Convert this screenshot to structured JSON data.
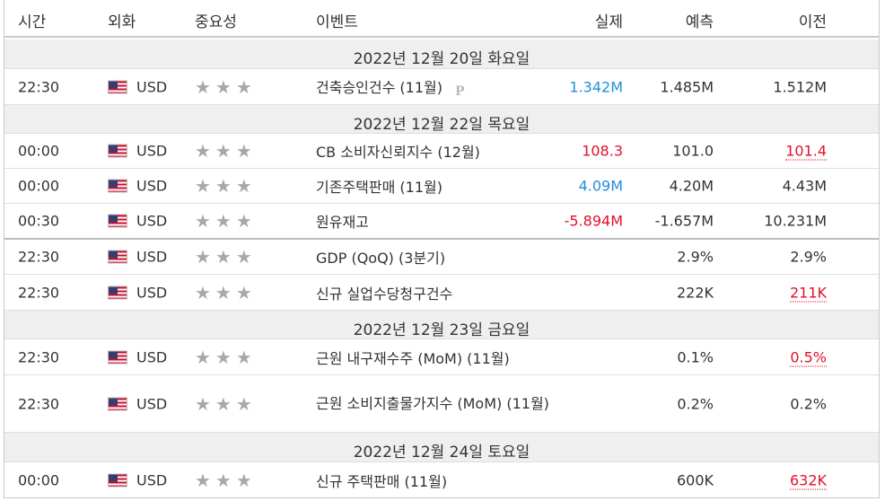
{
  "header": {
    "time": "시간",
    "currency": "외화",
    "importance": "중요성",
    "event": "이벤트",
    "actual": "실제",
    "forecast": "예측",
    "previous": "이전"
  },
  "dates": [
    "2022년 12월 20일 화요일",
    "2022년 12월 22일 목요일",
    "2022년 12월 23일 금요일",
    "2022년 12월 24일 토요일"
  ],
  "rows": [
    {
      "time": "22:30",
      "currency": "USD",
      "event": "건축승인건수 (11월)",
      "actual": "1.342M",
      "forecast": "1.485M",
      "previous": "1.512M"
    },
    {
      "time": "00:00",
      "currency": "USD",
      "event": "CB 소비자신뢰지수 (12월)",
      "actual": "108.3",
      "forecast": "101.0",
      "previous": "101.4"
    },
    {
      "time": "00:00",
      "currency": "USD",
      "event": "기존주택판매 (11월)",
      "actual": "4.09M",
      "forecast": "4.20M",
      "previous": "4.43M"
    },
    {
      "time": "00:30",
      "currency": "USD",
      "event": "원유재고",
      "actual": "-5.894M",
      "forecast": "-1.657M",
      "previous": "10.231M"
    },
    {
      "time": "22:30",
      "currency": "USD",
      "event": "GDP (QoQ) (3분기)",
      "actual": "",
      "forecast": "2.9%",
      "previous": "2.9%"
    },
    {
      "time": "22:30",
      "currency": "USD",
      "event": "신규 실업수당청구건수",
      "actual": "",
      "forecast": "222K",
      "previous": "211K"
    },
    {
      "time": "22:30",
      "currency": "USD",
      "event": "근원 내구재수주 (MoM) (11월)",
      "actual": "",
      "forecast": "0.1%",
      "previous": "0.5%"
    },
    {
      "time": "22:30",
      "currency": "USD",
      "event": "근원 소비지출물가지수 (MoM) (11월)",
      "actual": "",
      "forecast": "0.2%",
      "previous": "0.2%"
    },
    {
      "time": "00:00",
      "currency": "USD",
      "event": "신규 주택판매 (11월)",
      "actual": "",
      "forecast": "600K",
      "previous": "632K"
    }
  ],
  "importance_stars": "★★★",
  "watermark": "P",
  "colors": {
    "actual_positive": "#1e8fd8",
    "actual_negative": "#e0112b",
    "previous_revised": "#e0112b"
  }
}
